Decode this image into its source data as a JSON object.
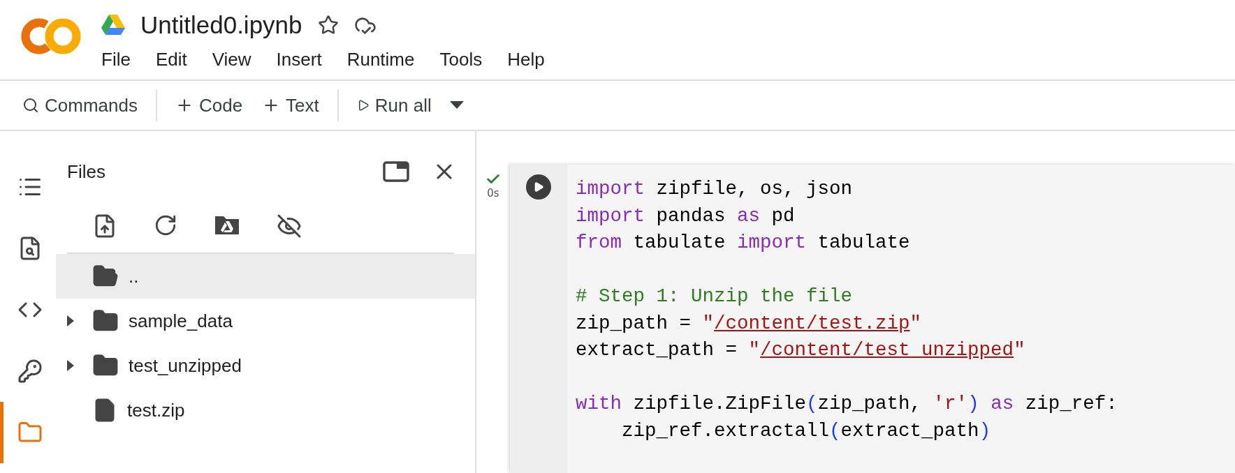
{
  "header": {
    "title": "Untitled0.ipynb",
    "starred": false,
    "menu": [
      "File",
      "Edit",
      "View",
      "Insert",
      "Runtime",
      "Tools",
      "Help"
    ]
  },
  "toolbar": {
    "commands": "Commands",
    "add_code": "Code",
    "add_text": "Text",
    "run_all": "Run all"
  },
  "rail": [
    {
      "kind": "toc",
      "selected": false
    },
    {
      "kind": "find",
      "selected": false
    },
    {
      "kind": "snippets",
      "selected": false
    },
    {
      "kind": "secrets",
      "selected": false
    },
    {
      "kind": "files",
      "selected": true
    }
  ],
  "files_panel": {
    "title": "Files",
    "items": [
      {
        "name": "..",
        "kind": "parent",
        "selected": true
      },
      {
        "name": "sample_data",
        "kind": "folder",
        "selected": false,
        "expanded": false
      },
      {
        "name": "test_unzipped",
        "kind": "folder",
        "selected": false,
        "expanded": false
      },
      {
        "name": "test.zip",
        "kind": "file",
        "selected": false
      }
    ]
  },
  "cell": {
    "completed": true,
    "time": "0s",
    "lines": [
      {
        "kind": "code",
        "tokens": [
          {
            "kind": "keyword",
            "text": "import"
          },
          {
            "kind": "plain",
            "text": " zipfile, os, json"
          }
        ]
      },
      {
        "kind": "code",
        "tokens": [
          {
            "kind": "keyword",
            "text": "import"
          },
          {
            "kind": "plain",
            "text": " pandas "
          },
          {
            "kind": "keyword",
            "text": "as"
          },
          {
            "kind": "plain",
            "text": " pd"
          }
        ]
      },
      {
        "kind": "code",
        "tokens": [
          {
            "kind": "keyword",
            "text": "from"
          },
          {
            "kind": "plain",
            "text": " tabulate "
          },
          {
            "kind": "keyword",
            "text": "import"
          },
          {
            "kind": "plain",
            "text": " tabulate"
          }
        ]
      },
      {
        "kind": "blank"
      },
      {
        "kind": "code",
        "tokens": [
          {
            "kind": "comment",
            "text": "# Step 1: Unzip the file"
          }
        ]
      },
      {
        "kind": "code",
        "tokens": [
          {
            "kind": "plain",
            "text": "zip_path = "
          },
          {
            "kind": "string",
            "text": "\""
          },
          {
            "kind": "path",
            "text": "/content/test.zip"
          },
          {
            "kind": "string",
            "text": "\""
          }
        ]
      },
      {
        "kind": "code",
        "tokens": [
          {
            "kind": "plain",
            "text": "extract_path = "
          },
          {
            "kind": "string",
            "text": "\""
          },
          {
            "kind": "path",
            "text": "/content/test_unzipped"
          },
          {
            "kind": "string",
            "text": "\""
          }
        ]
      },
      {
        "kind": "blank"
      },
      {
        "kind": "code",
        "tokens": [
          {
            "kind": "keyword",
            "text": "with"
          },
          {
            "kind": "plain",
            "text": " zipfile.ZipFile"
          },
          {
            "kind": "paren",
            "text": "("
          },
          {
            "kind": "plain",
            "text": "zip_path, "
          },
          {
            "kind": "string",
            "text": "'r'"
          },
          {
            "kind": "paren",
            "text": ")"
          },
          {
            "kind": "keyword",
            "text": " as"
          },
          {
            "kind": "plain",
            "text": " zip_ref:"
          }
        ]
      },
      {
        "kind": "code",
        "tokens": [
          {
            "kind": "plain",
            "text": "    zip_ref.extractall"
          },
          {
            "kind": "paren",
            "text": "("
          },
          {
            "kind": "plain",
            "text": "extract_path"
          },
          {
            "kind": "paren",
            "text": ")"
          }
        ]
      }
    ]
  }
}
